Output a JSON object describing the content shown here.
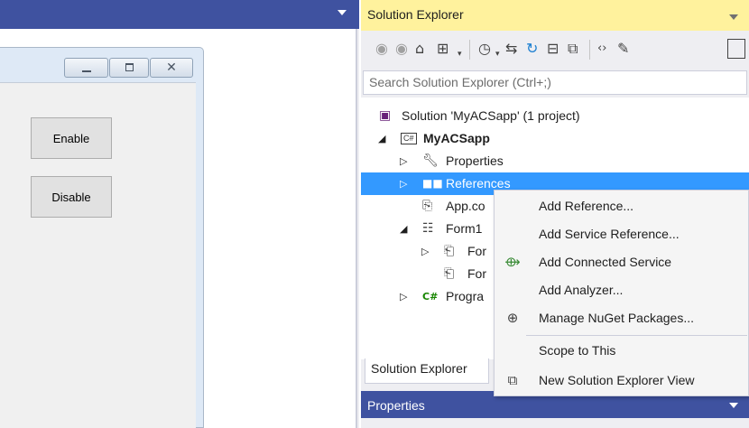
{
  "designer": {
    "buttons": {
      "enable": "Enable",
      "disable": "Disable"
    },
    "window_controls": {
      "close_glyph": "✕"
    }
  },
  "solution_explorer": {
    "title": "Solution Explorer",
    "search_placeholder": "Search Solution Explorer (Ctrl+;)",
    "toolbar_icons": [
      "back-icon",
      "forward-icon",
      "home-icon",
      "switch-views-icon",
      "pending-changes-icon",
      "sync-icon",
      "refresh-icon",
      "collapse-all-icon",
      "show-all-files-icon",
      "view-code-icon",
      "properties-icon"
    ],
    "tree": {
      "solution": "Solution 'MyACSapp' (1 project)",
      "project_badge": "C#",
      "project": "MyACSapp",
      "properties": "Properties",
      "references": "References",
      "app_config": "App.co",
      "form1": "Form1",
      "form1_child1": "For",
      "form1_child2": "For",
      "program_badge": "C#",
      "program": "Progra"
    },
    "bottom_tab": "Solution Explorer",
    "selection_color": "#3399ff",
    "title_color": "#fff29d"
  },
  "properties_panel": {
    "title": "Properties"
  },
  "context_menu": {
    "items": [
      {
        "label": "Add Reference...",
        "icon": ""
      },
      {
        "label": "Add Service Reference...",
        "icon": ""
      },
      {
        "label": "Add Connected Service",
        "icon": "connected-service-icon"
      },
      {
        "label": "Add Analyzer...",
        "icon": ""
      },
      {
        "label": "Manage NuGet Packages...",
        "icon": "nuget-package-icon"
      },
      {
        "label": "Scope to This",
        "icon": ""
      },
      {
        "label": "New Solution Explorer View",
        "icon": "new-view-icon"
      }
    ]
  }
}
